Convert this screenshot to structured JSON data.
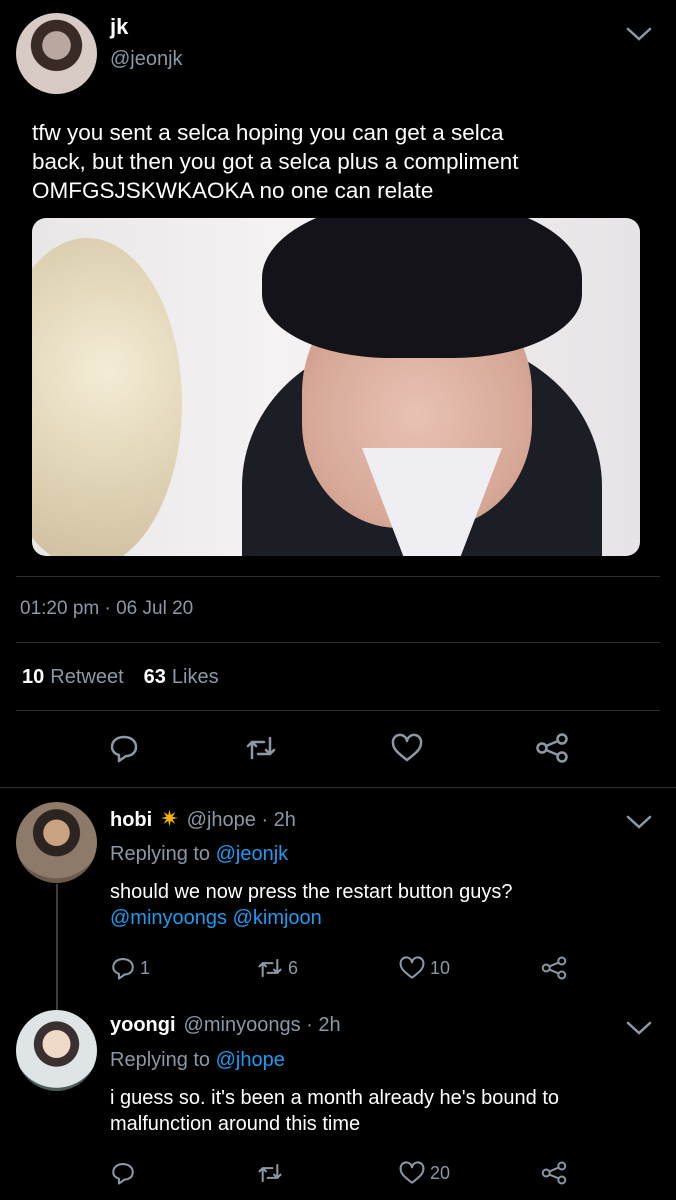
{
  "tweet": {
    "author_name": "jk",
    "author_handle": "@jeonjk",
    "text": "tfw you sent a selca hoping you can get a selca\nback, but then you got a selca plus a compliment\nOMFGSJSKWKAOKA no one can relate",
    "timestamp": "01:20 pm · 06 Jul 20",
    "retweets_count": "10",
    "retweets_label": "Retweet",
    "likes_count": "63",
    "likes_label": "Likes",
    "actions": [
      "reply-icon",
      "retweet-icon",
      "like-icon",
      "share-icon"
    ]
  },
  "replies": [
    {
      "name": "hobi",
      "emoji": "✷",
      "handle_time": "@jhope · 2h",
      "replying_label": "Replying to",
      "replying_to": "@jeonjk",
      "text": "should we now press the restart button guys?",
      "mentions": "@minyoongs @kimjoon",
      "reply_count": "1",
      "retweet_count": "6",
      "like_count": "10"
    },
    {
      "name": "yoongi",
      "handle_time": "@minyoongs · 2h",
      "replying_label": "Replying to",
      "replying_to": "@jhope",
      "text": "i guess so. it's been a month already he's bound to\nmalfunction around this time",
      "reply_count": "",
      "retweet_count": "",
      "like_count": "20"
    }
  ],
  "colors": {
    "background": "#000000",
    "text_primary": "#ffffff",
    "text_secondary": "#8b98a5",
    "link": "#1d9bf0",
    "emoji_star": "#f5b400"
  }
}
